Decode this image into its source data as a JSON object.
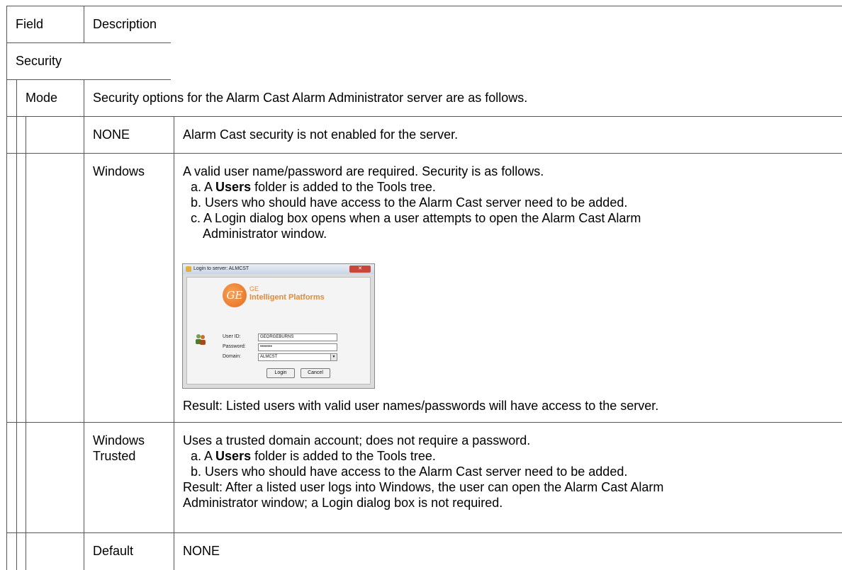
{
  "header": {
    "field": "Field",
    "description": "Description"
  },
  "section": {
    "title": "Security"
  },
  "mode": {
    "label": "Mode",
    "description": "Security options for the Alarm Cast Alarm Administrator server are as follows."
  },
  "options": [
    {
      "name": "NONE",
      "description": "Alarm Cast security is not enabled for the server."
    },
    {
      "name": "Windows",
      "intro": "A valid user name/password are required. Security is as follows.",
      "steps": [
        {
          "prefix": "a. A ",
          "bold": "Users",
          "suffix": " folder is added to the Tools tree."
        },
        {
          "text": "b. Users who should have access to the Alarm Cast server need to be added."
        },
        {
          "line1": "c. A Login dialog box opens when a user attempts to open the Alarm Cast Alarm",
          "line2": "Administrator window."
        }
      ],
      "result": "Result: Listed  users with valid user names/passwords will have access to the server."
    },
    {
      "name_line1": "Windows",
      "name_line2": "Trusted",
      "intro": "Uses a trusted domain account; does not require a password.",
      "steps": [
        {
          "prefix": "a. A ",
          "bold": "Users",
          "suffix": " folder is added to the Tools tree."
        },
        {
          "text": "b. Users who should have access to the Alarm Cast server need to be added."
        }
      ],
      "result_line1": "Result: After a listed user logs into Windows, the user can open the Alarm Cast Alarm",
      "result_line2": "Administrator window; a Login dialog box is not required."
    },
    {
      "name": "Default",
      "description": "NONE"
    }
  ],
  "login_dialog": {
    "title": "Login to server: ALMCST",
    "brand_line1": "GE",
    "brand_line2": "Intelligent Platforms",
    "logo_text": "GE",
    "user_id_label": "User ID:",
    "user_id_value": "GEORGEBURNS",
    "password_label": "Password:",
    "password_value": "••••••••",
    "domain_label": "Domain:",
    "domain_value": "ALMCST",
    "login_button": "Login",
    "cancel_button": "Cancel"
  },
  "colors": {
    "border": "#555555",
    "brand": "#e08a3a"
  }
}
